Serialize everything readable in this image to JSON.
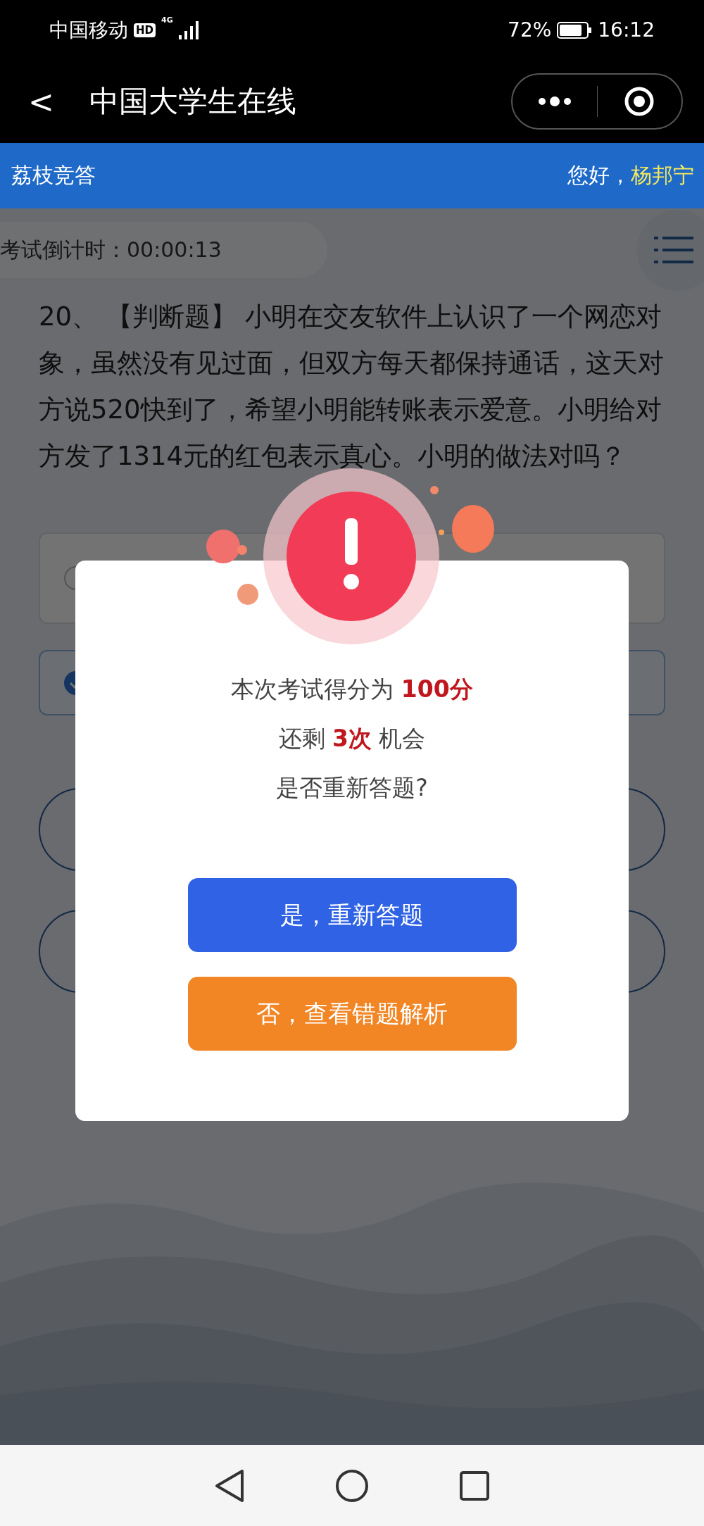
{
  "status_bar": {
    "carrier": "中国移动",
    "hd": "HD",
    "network": "4G",
    "battery": "72%",
    "time": "16:12"
  },
  "nav_bar": {
    "back": "<",
    "title": "中国大学生在线"
  },
  "header": {
    "title": "荔枝竞答",
    "greeting": "您好，",
    "user": "杨邦宁"
  },
  "timer": {
    "label": "考试倒计时：00:00:13"
  },
  "question": {
    "text": "20、 【判断题】 小明在交友软件上认识了一个网恋对象，虽然没有见过面，但双方每天都保持通话，这天对方说520快到了，希望小明能转账表示爱意。小明给对方发了1314元的红包表示真心。小明的做法对吗？"
  },
  "options": [
    {
      "selected": false
    },
    {
      "selected": true
    }
  ],
  "dialog": {
    "lines": [
      "本次考试得分为 **100分**",
      "还剩 **3次** 机会",
      "是否重新答题?"
    ],
    "buttons": [
      {
        "label": "是，重新答题",
        "kind": "primary"
      },
      {
        "label": "否，查看错题解析",
        "kind": "secondary"
      }
    ]
  }
}
